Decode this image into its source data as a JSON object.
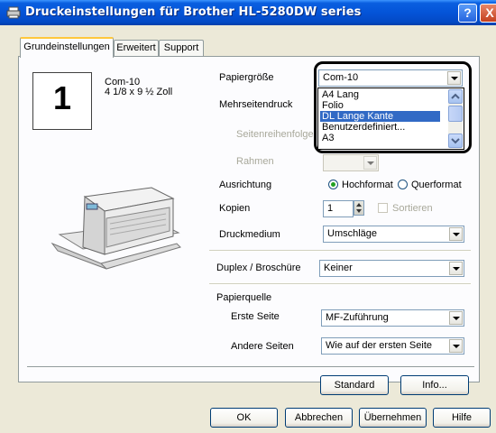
{
  "window": {
    "title": "Druckeinstellungen für Brother HL-5280DW series",
    "help": "?",
    "close": "X"
  },
  "tabs": [
    "Grundeinstellungen",
    "Erweitert",
    "Support"
  ],
  "preview": {
    "pages_per_sheet": "1",
    "paper_name": "Com-10",
    "paper_dims": "4 1/8 x 9 ½ Zoll"
  },
  "fields": {
    "paper_size": {
      "label": "Papiergröße",
      "value": "Com-10",
      "options": [
        "A4 Lang",
        "Folio",
        "DL Lange Kante",
        "Benutzerdefiniert...",
        "A3"
      ],
      "selected_index": 2
    },
    "multiple_page": {
      "label": "Mehrseitendruck"
    },
    "page_order": {
      "label": "Seitenreihenfolge"
    },
    "border": {
      "label": "Rahmen"
    },
    "orientation": {
      "label": "Ausrichtung",
      "portrait": "Hochformat",
      "landscape": "Querformat",
      "selected": "portrait"
    },
    "copies": {
      "label": "Kopien",
      "value": "1",
      "collate": "Sortieren"
    },
    "media": {
      "label": "Druckmedium",
      "value": "Umschläge"
    },
    "duplex": {
      "label": "Duplex / Broschüre",
      "value": "Keiner"
    },
    "paper_source": {
      "label": "Papierquelle",
      "first_page": {
        "label": "Erste Seite",
        "value": "MF-Zuführung"
      },
      "other_pages": {
        "label": "Andere Seiten",
        "value": "Wie auf der ersten Seite"
      }
    }
  },
  "buttons": {
    "standard": "Standard",
    "info": "Info...",
    "ok": "OK",
    "cancel": "Abbrechen",
    "apply": "Übernehmen",
    "help": "Hilfe"
  }
}
